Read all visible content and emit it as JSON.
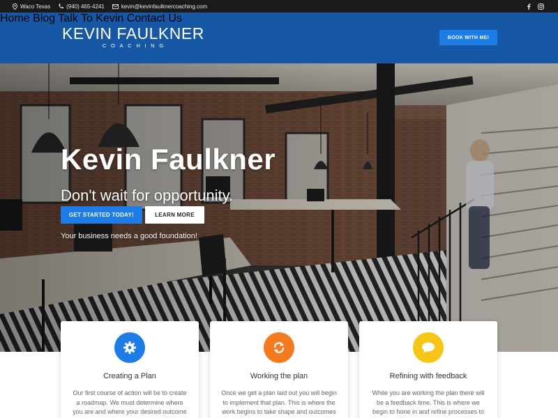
{
  "topbar": {
    "location": "Waco Texas",
    "phone": "(940) 465-4241",
    "email": "kevin@kevinfaulknercoaching.com",
    "social": [
      "facebook-icon",
      "instagram-icon"
    ]
  },
  "header": {
    "logo_line1": "KEVIN FAULKNER",
    "logo_line2": "COACHING",
    "nav": [
      "Home",
      "Blog",
      "Talk To Kevin",
      "Contact Us"
    ],
    "book_label": "BOOK WITH ME!",
    "bg_color": "#1758a6",
    "accent_color": "#1e7ce6"
  },
  "hero": {
    "title": "Kevin Faulkner",
    "subtitle": "Don't wait for opportunity.",
    "primary_button": "GET STARTED TODAY!",
    "secondary_button": "LEARN MORE",
    "tagline": "Your business needs a good foundation!"
  },
  "cards": [
    {
      "icon": "gear-icon",
      "color": "#1e7ce6",
      "title": "Creating a Plan",
      "text": "Our first course of action will be to create a roadmap. We must determine where you are and where your desired outcome is."
    },
    {
      "icon": "refresh-icon",
      "color": "#f47b20",
      "title": "Working the plan",
      "text": "Once we get a plan laid out you will begin to implement that plan. This is where the work begins to take shape and outcomes"
    },
    {
      "icon": "chat-bubble-icon",
      "color": "#f5c518",
      "title": "Refining with feedback",
      "text": "While you are working the plan there will be a feedback time. This is where we begin to hone in and refine processes to achieve"
    }
  ]
}
